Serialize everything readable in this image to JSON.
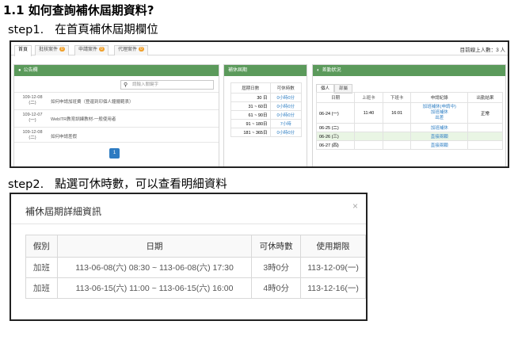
{
  "doc": {
    "heading": "1.1  如何查詢補休屆期資料?",
    "step1": {
      "num": "step1.",
      "text": "在首頁補休屆期欄位"
    },
    "step2": {
      "num": "step2.",
      "text": "點選可休時數，可以查看明細資料"
    }
  },
  "shot1": {
    "tabs": [
      {
        "label": "首頁"
      },
      {
        "label": "批核案件",
        "badge": "0"
      },
      {
        "label": "申請案件",
        "badge": "0"
      },
      {
        "label": "代理案件",
        "badge": "0"
      }
    ],
    "online_users": "目前線上人數：3 人",
    "bulletin": {
      "title": "公告欄",
      "search_placeholder": "請輸入關鍵字",
      "notices": [
        {
          "date": "109-12-08",
          "weekday": "(二)",
          "title": "如何申請加班費（登還到印個人鐘擺範表）"
        },
        {
          "date": "109-12-07",
          "weekday": "(一)",
          "title": "WebITR教育訓練教材-一般使用者"
        },
        {
          "date": "109-12-08",
          "weekday": "(二)",
          "title": "如何申請差假"
        }
      ],
      "page": "1"
    },
    "comp_leave": {
      "title": "補休屆期",
      "headers": [
        "屆期日數",
        "可休時數"
      ],
      "rows": [
        {
          "range": "30 日",
          "hours": "0小時0分"
        },
        {
          "range": "31 ~ 60日",
          "hours": "0小時0分"
        },
        {
          "range": "61 ~ 90日",
          "hours": "0小時0分"
        },
        {
          "range": "91 ~ 180日",
          "hours": "7小時"
        },
        {
          "range": "181 ~ 365日",
          "hours": "0小時0分"
        }
      ]
    },
    "attendance": {
      "title": "差勤狀況",
      "subtabs": [
        "個人",
        "部屬"
      ],
      "headers": [
        "日期",
        "上班卡",
        "下班卡",
        "申請紀錄",
        "出勤結果"
      ],
      "rows": [
        {
          "date": "06-24 (一)",
          "in": "11:40",
          "out": "16:01",
          "record": [
            "加班補休(申請中)",
            "加班補休",
            "出差"
          ],
          "result": "正常"
        },
        {
          "date": "06-25 (二)",
          "in": "",
          "out": "",
          "record": [
            "加班補休"
          ],
          "result": ""
        },
        {
          "date": "06-26 (三)",
          "in": "",
          "out": "",
          "record": [
            "直接兩顆"
          ],
          "result": ""
        },
        {
          "date": "06-27 (四)",
          "in": "",
          "out": "",
          "record": [
            "直接兩顆"
          ],
          "result": ""
        }
      ]
    }
  },
  "shot2": {
    "title": "補休屆期詳細資訊",
    "close": "×",
    "headers": [
      "假別",
      "日期",
      "可休時數",
      "使用期限"
    ],
    "rows": [
      {
        "type": "加班",
        "period": "113-06-08(六) 08:30 ~ 113-06-08(六) 17:30",
        "hours": "3時0分",
        "deadline": "113-12-09(一)"
      },
      {
        "type": "加班",
        "period": "113-06-15(六) 11:00 ~ 113-06-15(六) 16:00",
        "hours": "4時0分",
        "deadline": "113-12-16(一)"
      }
    ]
  }
}
